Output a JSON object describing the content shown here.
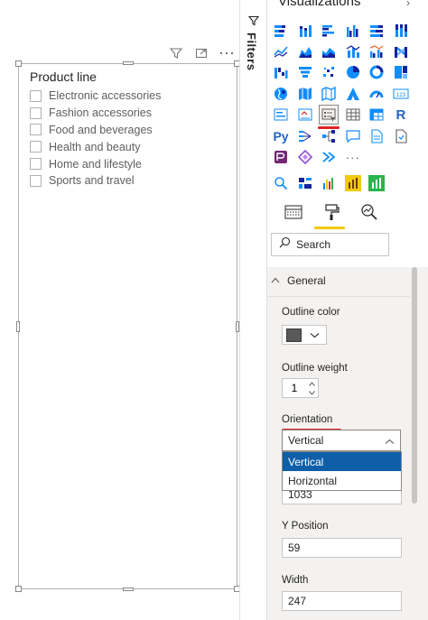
{
  "canvas": {
    "slicer": {
      "title": "Product line",
      "items": [
        "Electronic accessories",
        "Fashion accessories",
        "Food and beverages",
        "Health and beauty",
        "Home and lifestyle",
        "Sports and travel"
      ]
    },
    "visual_header_icons": [
      "filter-icon",
      "focus-mode-icon",
      "more-options-icon"
    ]
  },
  "filters_pane": {
    "label": "Filters"
  },
  "viz_pane": {
    "title": "Visualizations",
    "search": {
      "placeholder": "Search"
    },
    "general": {
      "label": "General",
      "outline_color": {
        "label": "Outline color",
        "value": "#595959"
      },
      "outline_weight": {
        "label": "Outline weight",
        "value": "1"
      },
      "orientation": {
        "label": "Orientation",
        "value": "Vertical",
        "options": [
          "Vertical",
          "Horizontal"
        ],
        "selected": "Vertical"
      },
      "x_position": {
        "value": "1033"
      },
      "y_position": {
        "label": "Y Position",
        "value": "59"
      },
      "width": {
        "label": "Width",
        "value": "247"
      }
    },
    "icon_names": [
      "stacked-bar-icon",
      "stacked-column-icon",
      "clustered-bar-icon",
      "clustered-column-icon",
      "100-stacked-bar-icon",
      "100-stacked-column-icon",
      "line-chart-icon",
      "area-chart-icon",
      "stacked-area-icon",
      "line-column-icon",
      "line-clustered-column-icon",
      "ribbon-chart-icon",
      "waterfall-icon",
      "funnel-icon",
      "scatter-icon",
      "pie-icon",
      "donut-icon",
      "treemap-icon",
      "map-icon",
      "filled-map-icon",
      "shape-map-icon",
      "azure-map-icon",
      "gauge-icon",
      "card-icon",
      "multi-row-card-icon",
      "kpi-icon",
      "slicer-icon",
      "table-icon",
      "matrix-icon",
      "r-visual-icon",
      "python-visual-icon",
      "key-influencers-icon",
      "decomposition-tree-icon",
      "qa-icon",
      "smart-narrative-icon",
      "paginated-report-icon",
      "power-apps-icon",
      "power-automate-icon",
      "arcgis-icon",
      "more-visuals-icon",
      "custom-search-icon",
      "custom-visual-a-icon",
      "custom-visual-b-icon",
      "custom-visual-c-icon",
      "custom-visual-d-icon"
    ],
    "more_visuals_glyph": "···",
    "r_glyph": "R",
    "py_glyph": "Py",
    "kpi_glyph": "123",
    "tabs": [
      "fields-tab-icon",
      "format-tab-icon",
      "analytics-tab-icon"
    ],
    "colors": {
      "accent_yellow": "#f2c811",
      "highlight_red": "#e02020",
      "selected_blue": "#0f5fa8"
    }
  }
}
